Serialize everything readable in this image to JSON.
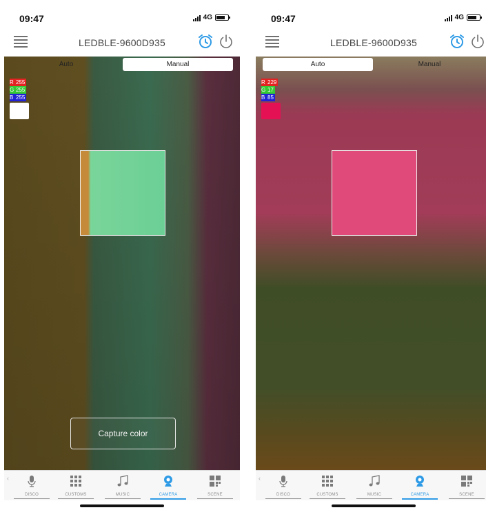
{
  "status_bar": {
    "time": "09:47",
    "network": "4G"
  },
  "header": {
    "device_name": "LEDBLE-9600D935"
  },
  "mode_toggle": {
    "auto_label": "Auto",
    "manual_label": "Manual"
  },
  "screens": [
    {
      "active_mode": "Manual",
      "rgb": {
        "r_label": "R",
        "r": "255",
        "g_label": "G",
        "g": "255",
        "b_label": "B",
        "b": "255"
      },
      "swatch_color": "#ffffff",
      "target_color": "#6ccf95",
      "capture_label": "Capture color"
    },
    {
      "active_mode": "Auto",
      "rgb": {
        "r_label": "R",
        "r": "229",
        "g_label": "G",
        "g": "17",
        "b_label": "B",
        "b": "85"
      },
      "swatch_color": "#e51155",
      "target_color": "#df4a7a"
    }
  ],
  "tabs": [
    {
      "label": "DISCO",
      "icon": "microphone-icon"
    },
    {
      "label": "CUSTOMS",
      "icon": "grid-icon"
    },
    {
      "label": "MUSIC",
      "icon": "music-note-icon"
    },
    {
      "label": "CAMERA",
      "icon": "camera-icon",
      "active": true
    },
    {
      "label": "SCENE",
      "icon": "scene-grid-icon"
    }
  ],
  "colors": {
    "accent": "#2f9be6",
    "icon_gray": "#6f6f6f",
    "alarm_blue": "#2f9be6"
  }
}
